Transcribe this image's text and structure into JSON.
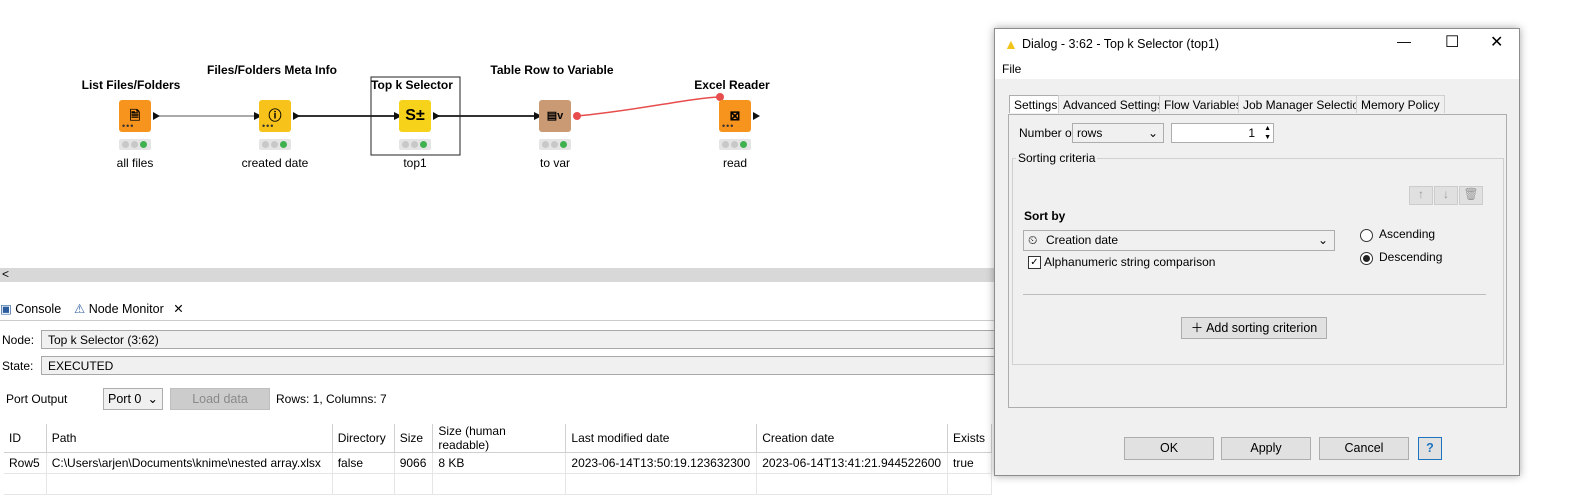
{
  "workflow": {
    "nodes": [
      {
        "title": "List Files/Folders",
        "label": "all files",
        "color": "#f7941d"
      },
      {
        "title": "Files/Folders Meta Info",
        "label": "created date",
        "color": "#f7c21a"
      },
      {
        "title": "Top k Selector",
        "label": "top1",
        "color": "#f7d21a"
      },
      {
        "title": "Table Row to Variable",
        "label": "to var",
        "color": "#c99a73"
      },
      {
        "title": "Excel Reader",
        "label": "read",
        "color": "#f7941d"
      }
    ],
    "connection_flow_var_color": "#e84d4d"
  },
  "scroll": {
    "left_arrow": "<"
  },
  "bottom": {
    "tabs": [
      {
        "label": "Console"
      },
      {
        "label": "Node Monitor"
      }
    ],
    "node_label": "Node:",
    "node_value": "Top k Selector  (3:62)",
    "state_label": "State:",
    "state_value": "EXECUTED",
    "port_output_label": "Port Output",
    "port_select": "Port 0",
    "load_data": "Load data",
    "rows_cols": "Rows: 1, Columns: 7",
    "table": {
      "columns": [
        "ID",
        "Path",
        "Directory",
        "Size",
        "Size (human readable)",
        "Last modified date",
        "Creation date",
        "Exists"
      ],
      "rows": [
        [
          "Row5",
          "C:\\Users\\arjen\\Documents\\knime\\nested array.xlsx",
          "false",
          "9066",
          "8 KB",
          "2023-06-14T13:50:19.123632300",
          "2023-06-14T13:41:21.944522600",
          "true"
        ]
      ]
    }
  },
  "dialog": {
    "title": "Dialog - 3:62 - Top k Selector (top1)",
    "menu_file": "File",
    "tabs": [
      "Settings",
      "Advanced Settings",
      "Flow Variables",
      "Job Manager Selection",
      "Memory Policy"
    ],
    "number_of_label": "Number of",
    "number_of_unit": "rows",
    "number_of_value": "1",
    "sorting_criteria_label": "Sorting criteria",
    "sort_by_label": "Sort by",
    "sort_by_value": "Creation date",
    "alphanumeric_label": "Alphanumeric string comparison",
    "alphanumeric_checked": true,
    "ascending_label": "Ascending",
    "descending_label": "Descending",
    "order_selected": "Descending",
    "add_criterion": "Add sorting criterion",
    "ok": "OK",
    "apply": "Apply",
    "cancel": "Cancel",
    "help": "?"
  }
}
